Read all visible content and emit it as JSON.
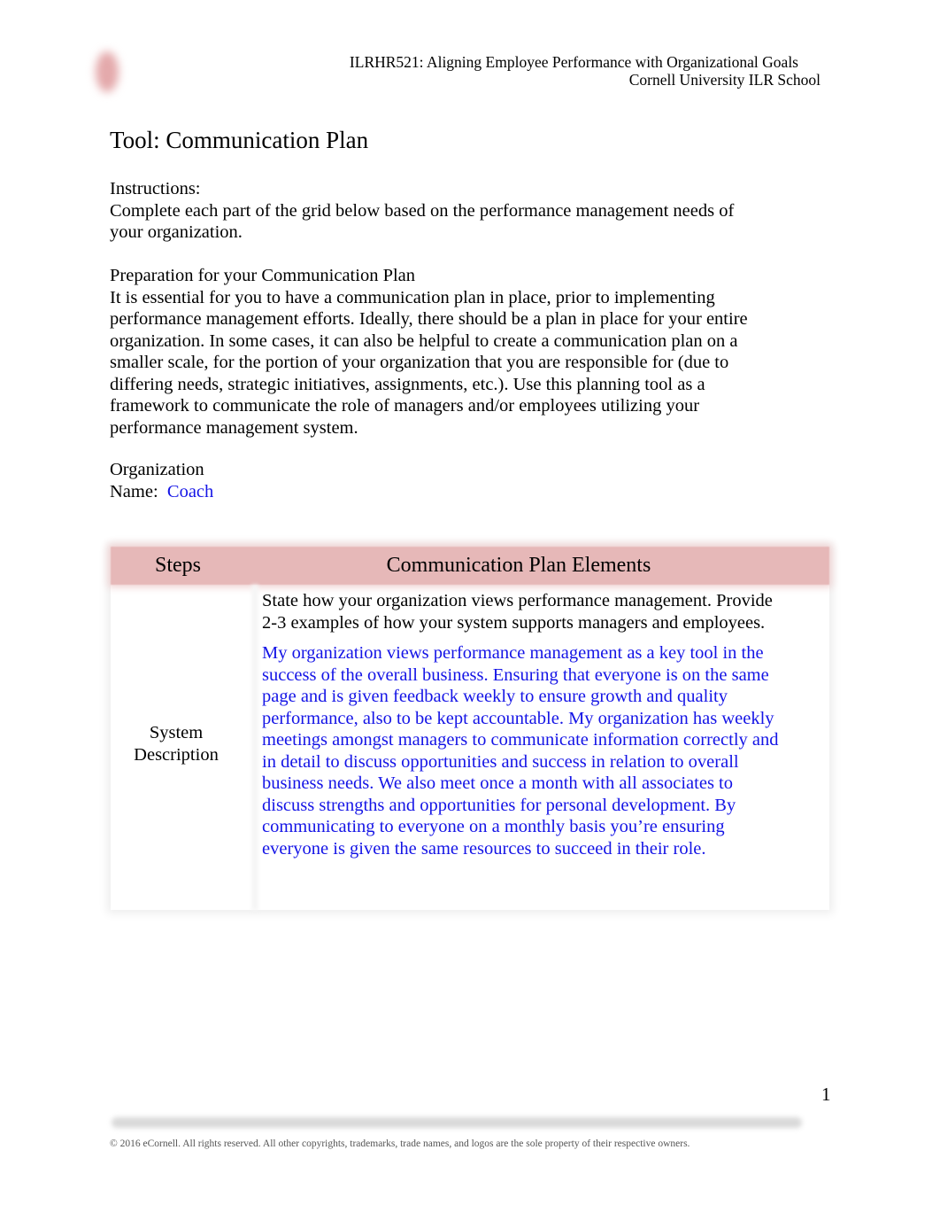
{
  "header": {
    "logo_icon": "cornell-logo-icon",
    "course": "ILRHR521: Aligning Employee Performance with Organizational Goals",
    "school": "Cornell University ILR School"
  },
  "title": "Tool: Communication Plan",
  "instructions": {
    "heading": "Instructions:",
    "text": "Complete each part of the grid below based on the performance management needs of your organization."
  },
  "preparation": {
    "heading": "Preparation for your Communication Plan",
    "text": "It is essential for you to have a communication plan in place, prior to implementing performance management efforts. Ideally, there should be a plan in place for your entire organization. In some cases, it can also be helpful to create a communication plan on a smaller scale, for the portion of your organization that you are responsible for (due to differing needs, strategic initiatives, assignments, etc.). Use this planning tool as a framework to communicate the role of managers and/or employees utilizing your performance management system."
  },
  "organization": {
    "label_line1": "Organization",
    "label_line2": "Name:",
    "value": "Coach"
  },
  "table": {
    "headers": [
      "Steps",
      "Communication Plan Elements"
    ],
    "header_color": "#e6b8b8",
    "rows": [
      {
        "step_line1": "System",
        "step_line2": "Description",
        "prompt": "State how your organization views performance management. Provide 2-3 examples of how your system supports managers and employees.",
        "answer": "My organization views performance management as a key tool in the success of the overall business. Ensuring that everyone is on the same page and is given feedback weekly to ensure growth and quality performance, also to be kept accountable. My organization has weekly meetings amongst managers to communicate information correctly and in detail to discuss opportunities and success in relation to overall business needs. We also meet once a month with all associates to discuss strengths and opportunities for personal development. By communicating to everyone on a monthly basis you’re ensuring everyone is given the same resources to succeed in their role."
      }
    ]
  },
  "answer_color": "#1414e6",
  "page_number": "1",
  "footer": {
    "copyright": "© 2016 eCornell. All rights reserved. All other copyrights, trademarks, trade names, and logos are the sole property of their respective owners."
  }
}
